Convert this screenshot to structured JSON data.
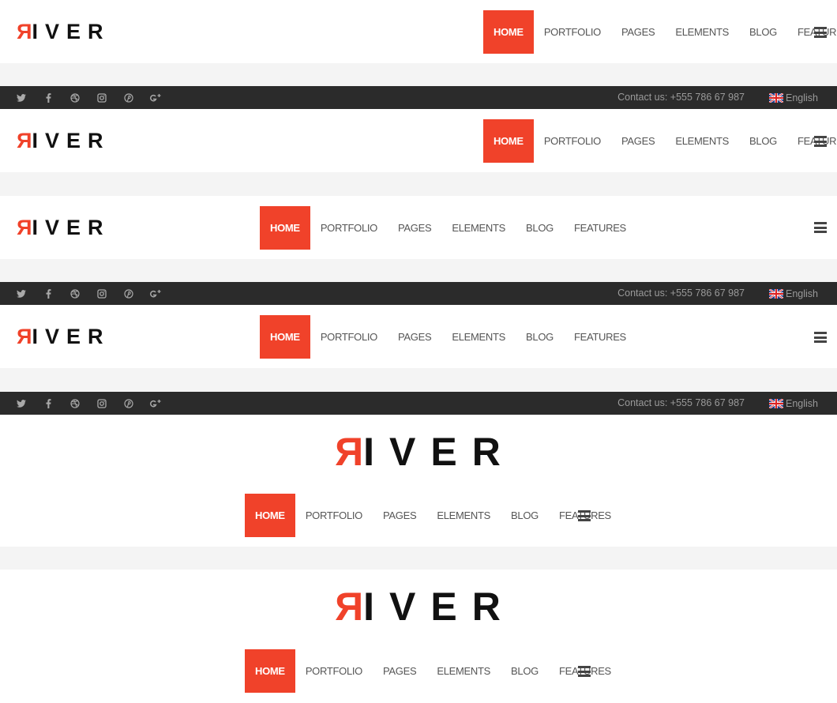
{
  "brand": {
    "logo_first": "R",
    "logo_rest": "IVER"
  },
  "nav": {
    "items": [
      {
        "label": "HOME",
        "active": true
      },
      {
        "label": "PORTFOLIO"
      },
      {
        "label": "PAGES"
      },
      {
        "label": "ELEMENTS"
      },
      {
        "label": "BLOG"
      },
      {
        "label": "FEATURES"
      }
    ]
  },
  "topbar": {
    "socials": [
      "twitter-icon",
      "facebook-icon",
      "dribbble-icon",
      "instagram-icon",
      "pinterest-icon",
      "google-plus-icon"
    ],
    "contact": "Contact us: +555 786 67 987",
    "language": "English"
  },
  "colors": {
    "accent": "#f0422a",
    "topbar": "#2b2b2b",
    "header": "#ffffff",
    "page": "#f4f4f4"
  }
}
